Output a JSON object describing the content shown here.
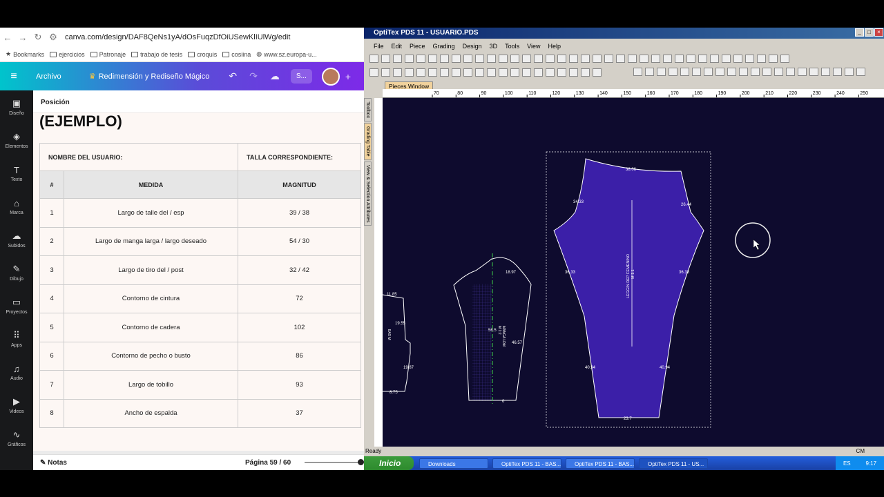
{
  "browser": {
    "url": "canva.com/design/DAF8QeNs1yA/dOsFuqzDfOiUSewKlIUlWg/edit",
    "bookmarks": [
      "Bookmarks",
      "ejercicios",
      "Patronaje",
      "trabajo de tesis",
      "croquis",
      "cosiina",
      "www.sz.europa-u..."
    ]
  },
  "canva": {
    "menu_archivo": "Archivo",
    "magic_label": "Redimensión y Rediseño Mágico",
    "share_short": "S...",
    "sidebar": [
      {
        "label": "Diseño",
        "icon": "▣"
      },
      {
        "label": "Elementos",
        "icon": "◈"
      },
      {
        "label": "Texto",
        "icon": "T"
      },
      {
        "label": "Marca",
        "icon": "⌂"
      },
      {
        "label": "Subidos",
        "icon": "☁"
      },
      {
        "label": "Dibujo",
        "icon": "✎"
      },
      {
        "label": "Proyectos",
        "icon": "▭"
      },
      {
        "label": "Apps",
        "icon": "⠿"
      },
      {
        "label": "Audio",
        "icon": "♫"
      },
      {
        "label": "Videos",
        "icon": "▶"
      },
      {
        "label": "Gráficos",
        "icon": "∿"
      }
    ],
    "position_label": "Posición",
    "heading": "(EJEMPLO)",
    "table": {
      "user_label": "NOMBRE DEL USUARIO:",
      "size_label": "TALLA CORRESPONDIENTE:",
      "headers": [
        "#",
        "MEDIDA",
        "MAGNITUD"
      ],
      "rows": [
        [
          "1",
          "Largo de talle del / esp",
          "39 / 38"
        ],
        [
          "2",
          "Largo de manga larga / largo deseado",
          "54 / 30"
        ],
        [
          "3",
          "Largo de tiro del / post",
          "32 / 42"
        ],
        [
          "4",
          "Contorno de cintura",
          "72"
        ],
        [
          "5",
          "Contorno de cadera",
          "102"
        ],
        [
          "6",
          "Contorno de pecho o busto",
          "86"
        ],
        [
          "7",
          "Largo de tobillo",
          "93"
        ],
        [
          "8",
          "Ancho de espalda",
          "37"
        ]
      ]
    },
    "notes_label": "Notas",
    "page_label": "Página 59 / 60"
  },
  "optitex": {
    "title": "OptiTex PDS 11 - USUARIO.PDS",
    "menus": [
      "File",
      "Edit",
      "Piece",
      "Grading",
      "Design",
      "3D",
      "Tools",
      "View",
      "Help"
    ],
    "pieces_window": "Pieces Window",
    "side_tabs": [
      "Toolbox",
      "Grading Table",
      "View & Selection Attributes"
    ],
    "ruler_labels": [
      "70",
      "80",
      "90",
      "100",
      "110",
      "120",
      "130",
      "140",
      "150",
      "160",
      "170",
      "180",
      "190",
      "200",
      "210",
      "220",
      "230",
      "240",
      "250"
    ],
    "piece_labels": {
      "legging_name": "LEGGIN DEP FEMENINO",
      "legging_size": "M 1:1",
      "sleeve_name": "MANGA LDM",
      "sleeve_size": "M 1:2",
      "small_name": "BAS M",
      "m1": "38.06",
      "m2": "34.33",
      "m3": "26.44",
      "m4": "36.33",
      "m5": "36.33",
      "m6": "40.94",
      "m7": "40.94",
      "m8": "23.7",
      "s1": "18.97",
      "s2": "56.5",
      "s3": "46.57",
      "s4": "0",
      "t1": "11.85",
      "t2": "19.55",
      "t3": "19.87",
      "t4": "8.75"
    },
    "status": "Ready",
    "units": "CM",
    "taskbar": {
      "start": "Inicio",
      "items": [
        "Downloads",
        "OptiTex PDS 11 - BAS...",
        "OptiTex PDS 11 - BAS...",
        "OptiTex PDS 11 - US..."
      ],
      "lang": "ES",
      "time": "9:17"
    }
  }
}
